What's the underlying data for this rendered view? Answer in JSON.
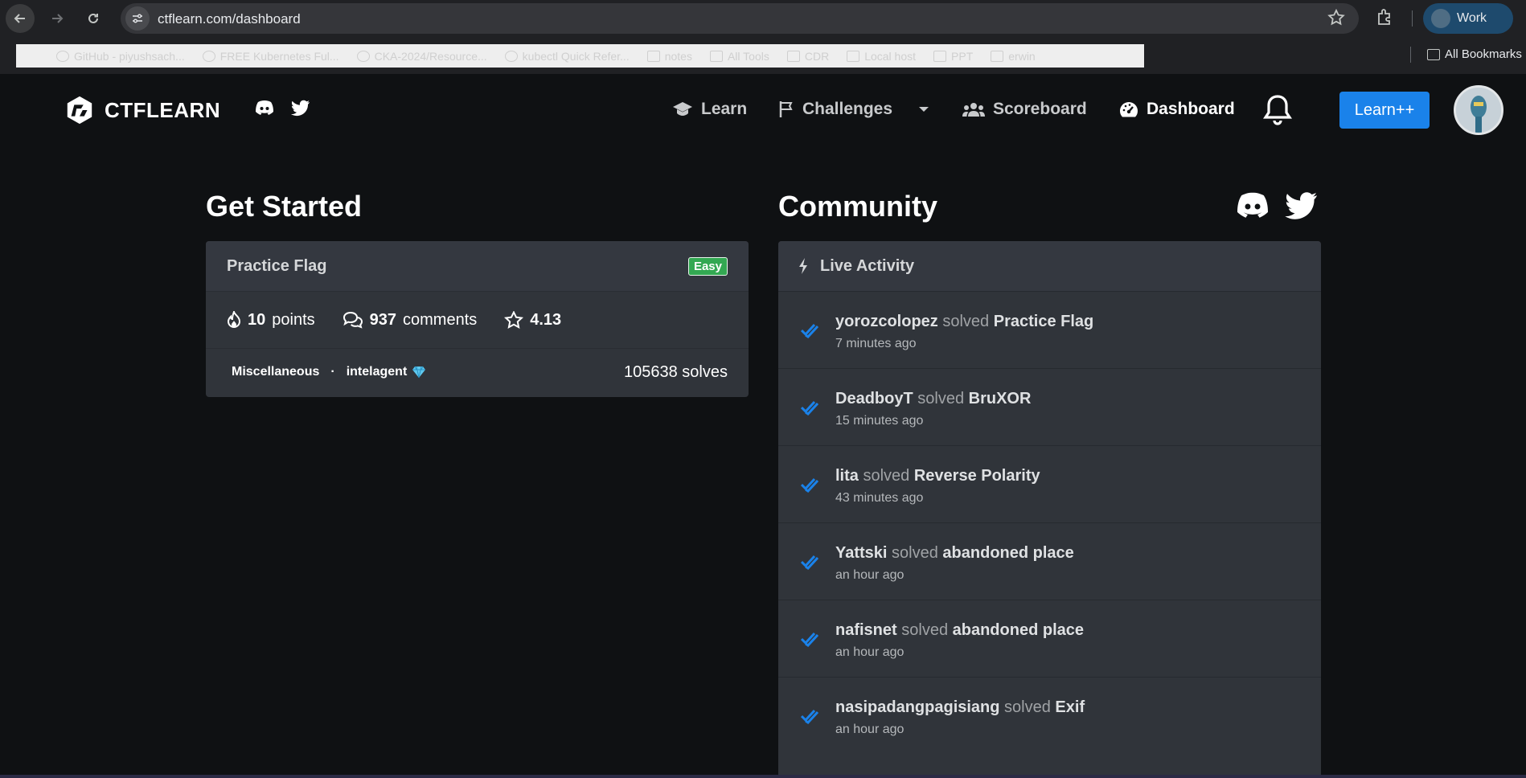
{
  "browser": {
    "url": "ctflearn.com/dashboard",
    "profile_label": "Work",
    "bookmarks": [
      {
        "label": "GitHub - piyushsach...",
        "icon": "github-icon"
      },
      {
        "label": "FREE Kubernetes Ful...",
        "icon": "youtube-icon"
      },
      {
        "label": "CKA-2024/Resource...",
        "icon": "github-icon"
      },
      {
        "label": "kubectl Quick Refer...",
        "icon": "kubernetes-icon"
      },
      {
        "label": "notes",
        "icon": "folder-icon"
      },
      {
        "label": "All Tools",
        "icon": "folder-icon"
      },
      {
        "label": "CDR",
        "icon": "folder-icon"
      },
      {
        "label": "Local host",
        "icon": "folder-icon"
      },
      {
        "label": "PPT",
        "icon": "folder-icon"
      },
      {
        "label": "erwin",
        "icon": "folder-icon"
      }
    ],
    "all_bookmarks_label": "All Bookmarks"
  },
  "site": {
    "logo_text": "CTFLEARN",
    "nav": {
      "learn": "Learn",
      "challenges": "Challenges",
      "scoreboard": "Scoreboard",
      "dashboard": "Dashboard",
      "learnpp": "Learn++"
    },
    "accent_color": "#1a82ea"
  },
  "get_started": {
    "title": "Get Started",
    "challenge": {
      "name": "Practice Flag",
      "difficulty": "Easy",
      "points_value": "10",
      "points_label": "points",
      "comments_value": "937",
      "comments_label": "comments",
      "rating": "4.13",
      "category": "Miscellaneous",
      "separator": "·",
      "author": "intelagent",
      "solves": "105638 solves"
    }
  },
  "community": {
    "title": "Community",
    "live_activity_label": "Live Activity",
    "activity": [
      {
        "user": "yorozcolopez",
        "verb": "solved",
        "challenge": "Practice Flag",
        "time": "7 minutes ago"
      },
      {
        "user": "DeadboyT",
        "verb": "solved",
        "challenge": "BruXOR",
        "time": "15 minutes ago"
      },
      {
        "user": "lita",
        "verb": "solved",
        "challenge": "Reverse Polarity",
        "time": "43 minutes ago"
      },
      {
        "user": "Yattski",
        "verb": "solved",
        "challenge": "abandoned place",
        "time": "an hour ago"
      },
      {
        "user": "nafisnet",
        "verb": "solved",
        "challenge": "abandoned place",
        "time": "an hour ago"
      },
      {
        "user": "nasipadangpagisiang",
        "verb": "solved",
        "challenge": "Exif",
        "time": "an hour ago"
      }
    ]
  }
}
